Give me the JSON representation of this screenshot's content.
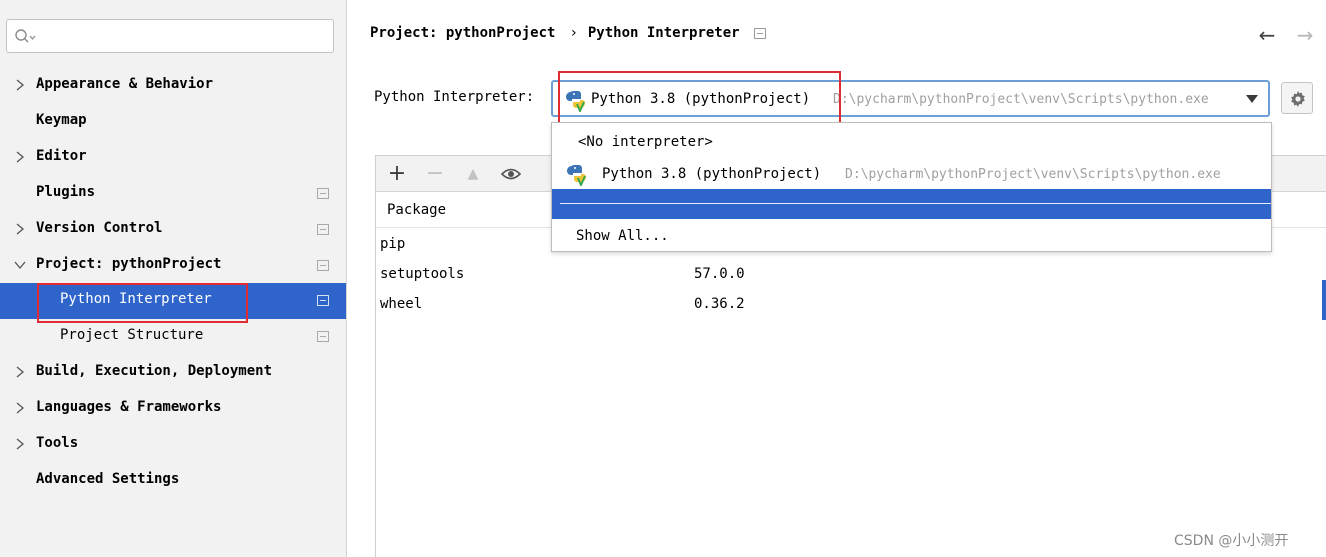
{
  "search": {
    "placeholder": "",
    "value": ""
  },
  "sidebar": {
    "items": [
      {
        "label": "Appearance & Behavior",
        "expandable": true
      },
      {
        "label": "Keymap",
        "expandable": false
      },
      {
        "label": "Editor",
        "expandable": true
      },
      {
        "label": "Plugins",
        "expandable": false
      },
      {
        "label": "Version Control",
        "expandable": true
      },
      {
        "label": "Project: pythonProject",
        "expandable": true,
        "expanded": true
      },
      {
        "label": "Python Interpreter",
        "selected": true
      },
      {
        "label": "Project Structure"
      },
      {
        "label": "Build, Execution, Deployment",
        "expandable": true
      },
      {
        "label": "Languages & Frameworks",
        "expandable": true
      },
      {
        "label": "Tools",
        "expandable": true
      },
      {
        "label": "Advanced Settings",
        "expandable": false
      }
    ]
  },
  "breadcrumb": {
    "project": "Project: pythonProject",
    "separator": "›",
    "page": "Python Interpreter"
  },
  "nav": {
    "back": "←",
    "forward": "→"
  },
  "interpreter": {
    "label": "Python Interpreter:",
    "selected_name": "Python 3.8 (pythonProject)",
    "selected_path": "D:\\pycharm\\pythonProject\\venv\\Scripts\\python.exe"
  },
  "dropdown": {
    "no_interpreter": "<No interpreter>",
    "option_name": "Python 3.8 (pythonProject)",
    "option_path": "D:\\pycharm\\pythonProject\\venv\\Scripts\\python.exe",
    "show_all": "Show All..."
  },
  "packages": {
    "toolbar": {
      "add": "+",
      "remove": "−",
      "upgrade": "▲"
    },
    "header": {
      "package": "Package"
    },
    "rows": [
      {
        "name": "pip",
        "version": ""
      },
      {
        "name": "setuptools",
        "version": "57.0.0"
      },
      {
        "name": "wheel",
        "version": "0.36.2"
      }
    ]
  },
  "watermark": "CSDN @小小测开",
  "colors": {
    "selection": "#2f65ca",
    "highlight_box": "#e02c32",
    "focus_border": "#6c9fd8"
  }
}
